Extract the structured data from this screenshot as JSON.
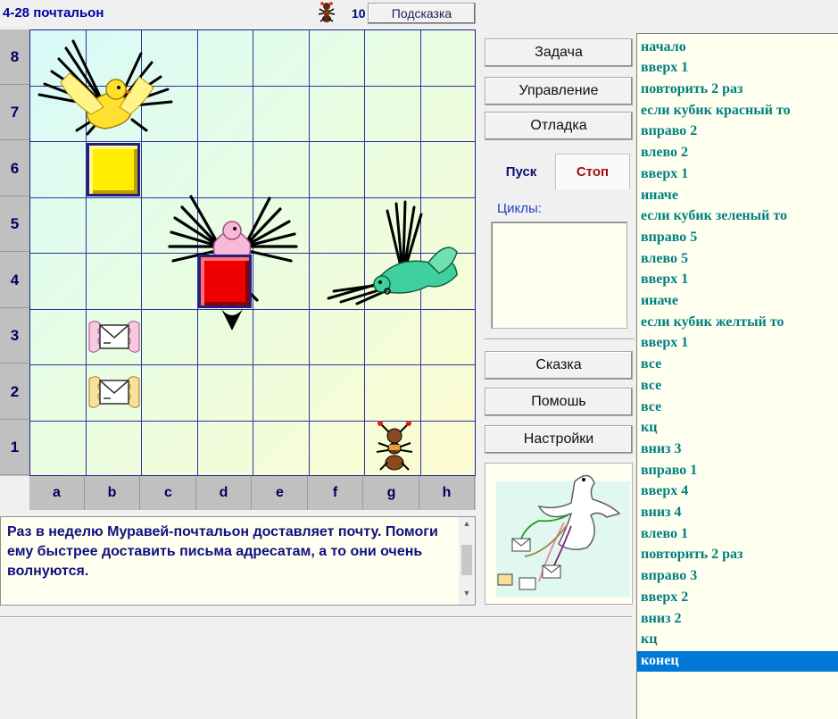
{
  "header": {
    "title": "4-28 почтальон",
    "counter": "10",
    "hint_button": "Подсказка"
  },
  "board": {
    "row_labels": [
      "8",
      "7",
      "6",
      "5",
      "4",
      "3",
      "2",
      "1"
    ],
    "col_labels": [
      "a",
      "b",
      "c",
      "d",
      "e",
      "f",
      "g",
      "h"
    ]
  },
  "buttons": {
    "task": "Задача",
    "control": "Управление",
    "debug": "Отладка",
    "run": "Пуск",
    "stop": "Стоп",
    "tale": "Сказка",
    "help": "Помошь",
    "settings": "Настройки"
  },
  "cycles_label": "Циклы:",
  "description": "Раз в неделю Муравей-почтальон доставляет почту. Помоги ему быстрее доставить письма адресатам, а то они очень волнуются.",
  "program": [
    "начало",
    "вверх 1",
    "повторить 2 раз",
    "если кубик красный то",
    "вправо 2",
    "влево 2",
    "вверх 1",
    "иначе",
    "если кубик зеленый то",
    "вправо 5",
    "влево 5",
    "вверх 1",
    "иначе",
    "если кубик желтый то",
    "вверх 1",
    "все",
    "все",
    "все",
    "кц",
    "вниз 3",
    "вправо 1",
    "вверх 4",
    "вниз 4",
    "влево 1",
    "повторить 2 раз",
    "вправо 3",
    "вверх 2",
    "вниз 2",
    "кц",
    "конец"
  ],
  "selected_line": "конец",
  "colors": {
    "cube_yellow": "#ffee00",
    "cube_red": "#ee0000",
    "program_text": "#008080",
    "selection": "#0078d7"
  },
  "icons": [
    "ant-icon",
    "bird-icon",
    "envelope-icon",
    "dove-icon"
  ]
}
